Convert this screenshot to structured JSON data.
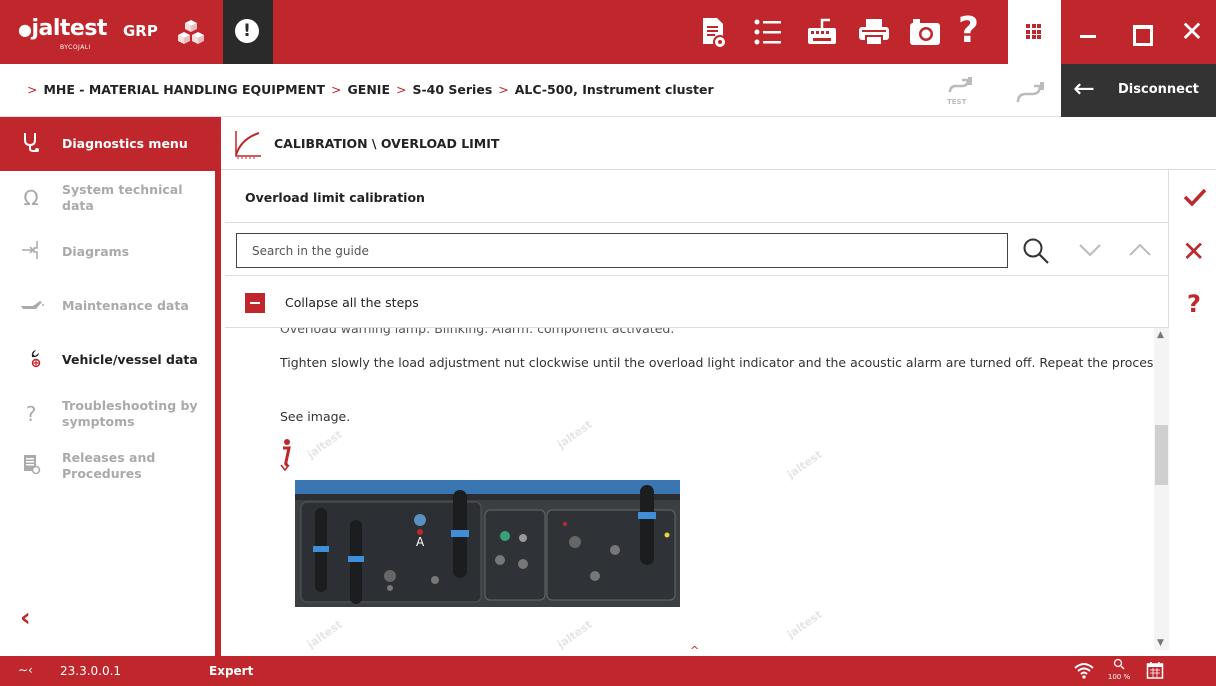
{
  "topbar": {
    "brand": "jaltest",
    "brand_sub": "BYCOJALI",
    "grp": "GRP",
    "alert": "!",
    "help": "?",
    "close": "✕",
    "tools": [
      "report-icon",
      "list-icon",
      "keyboard-icon",
      "printer-icon",
      "camera-icon"
    ]
  },
  "breadcrumb": {
    "items": [
      "MHE - MATERIAL HANDLING EQUIPMENT",
      "GENIE",
      "S-40 Series",
      "ALC-500, Instrument cluster"
    ],
    "test_label": "TEST",
    "disconnect_label": "Disconnect"
  },
  "sidebar": {
    "items": [
      {
        "label": "Diagnostics menu",
        "icon": "stethoscope-icon",
        "state": "active"
      },
      {
        "label": "System technical data",
        "icon": "omega-icon",
        "state": "disabled"
      },
      {
        "label": "Diagrams",
        "icon": "diagram-icon",
        "state": "disabled"
      },
      {
        "label": "Maintenance data",
        "icon": "oil-can-icon",
        "state": "disabled"
      },
      {
        "label": "Vehicle/vessel data",
        "icon": "wrench-icon",
        "state": "normal"
      },
      {
        "label": "Troubleshooting by symptoms",
        "icon": "troubleshoot-icon",
        "state": "disabled"
      },
      {
        "label": "Releases and Procedures",
        "icon": "procedures-icon",
        "state": "disabled"
      }
    ]
  },
  "main": {
    "header_title": "CALIBRATION \\ OVERLOAD LIMIT",
    "panel_title": "Overload limit calibration",
    "search_placeholder": "Search in the guide",
    "collapse_label": "Collapse all the steps",
    "partial_line": "Overload warning lamp: Blinking. Alarm: component activated.",
    "paragraph": "Tighten slowly the load adjustment nut clockwise until the overload light indicator and the acoustic alarm are turned off. Repeat the process.",
    "see_image": "See image.",
    "photo_label": "A",
    "watermark": "jaltest"
  },
  "actions": {
    "confirm": "check-icon",
    "cancel": "✕",
    "help": "?"
  },
  "status": {
    "version": "23.3.0.0.1",
    "mode": "Expert",
    "zoom": "100 %"
  },
  "colors": {
    "brand_red": "#c0272d",
    "dark": "#333333"
  }
}
